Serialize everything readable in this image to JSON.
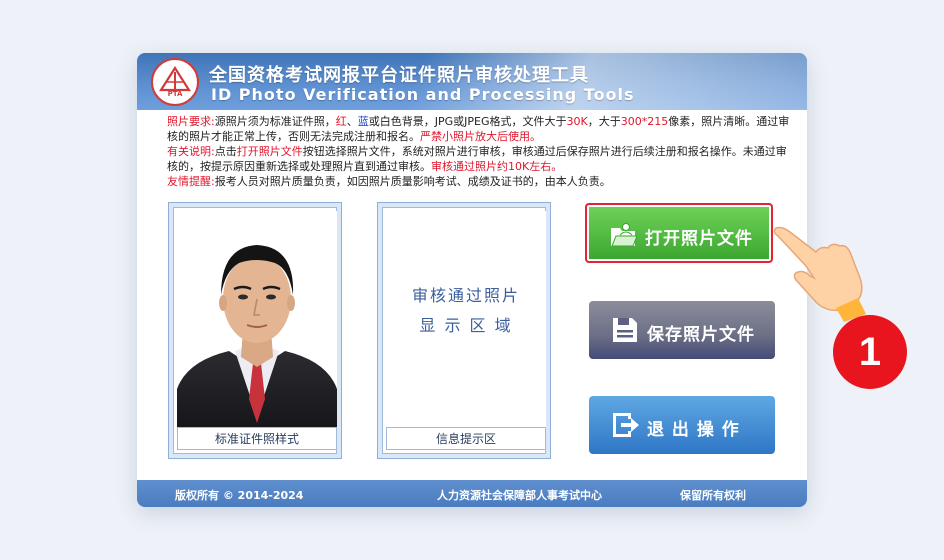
{
  "app": {
    "title_cn": "全国资格考试网报平台证件照片审核处理工具",
    "title_en": "ID Photo Verification and Processing Tools",
    "logo_text": "PTA"
  },
  "notes": {
    "req_label": "照片要求:",
    "req_text_1": "源照片须为标准证件照，",
    "req_red": "红",
    "req_sep1": "、",
    "req_blue": "蓝",
    "req_or": "或",
    "req_white": "白",
    "req_text_2": "色背景，JPG或JPEG格式，文件大于",
    "req_size": "30K",
    "req_text_3": "，大于",
    "req_pixels": "300*215",
    "req_text_4": "像素，照片清晰。通过审核的照片才能正常上传，否则无法完成注册和报名。",
    "req_warn": "严禁小照片放大后使用。",
    "info_label": "有关说明:",
    "info_text_1": "点击",
    "info_open": "打开照片文件",
    "info_text_2": "按钮选择照片文件，系统对照片进行审核，审核通过后保存照片进行后续注册和报名操作。未通过审核的，按提示原因重新选择或处理照片直到通过审核。",
    "info_red": "审核通过照片约10K左右。",
    "tip_label": "友情提醒:",
    "tip_text": "报考人员对照片质量负责，如因照片质量影响考试、成绩及证书的，由本人负责。"
  },
  "panels": {
    "sample_caption": "标准证件照样式",
    "review_line1": "审核通过照片",
    "review_line2": "显 示 区 域",
    "info_caption": "信息提示区"
  },
  "buttons": {
    "open": "打开照片文件",
    "save": "保存照片文件",
    "exit": "退 出 操 作"
  },
  "footer": {
    "copyright": "版权所有 © 2014-2024",
    "center": "人力资源社会保障部人事考试中心",
    "rights": "保留所有权利"
  },
  "overlay": {
    "step_number": "1"
  },
  "colors": {
    "header_blue": "#4f84c6",
    "accent_red": "#e0162b",
    "open_green": "#3aa52f",
    "exit_blue": "#2f76c6"
  }
}
